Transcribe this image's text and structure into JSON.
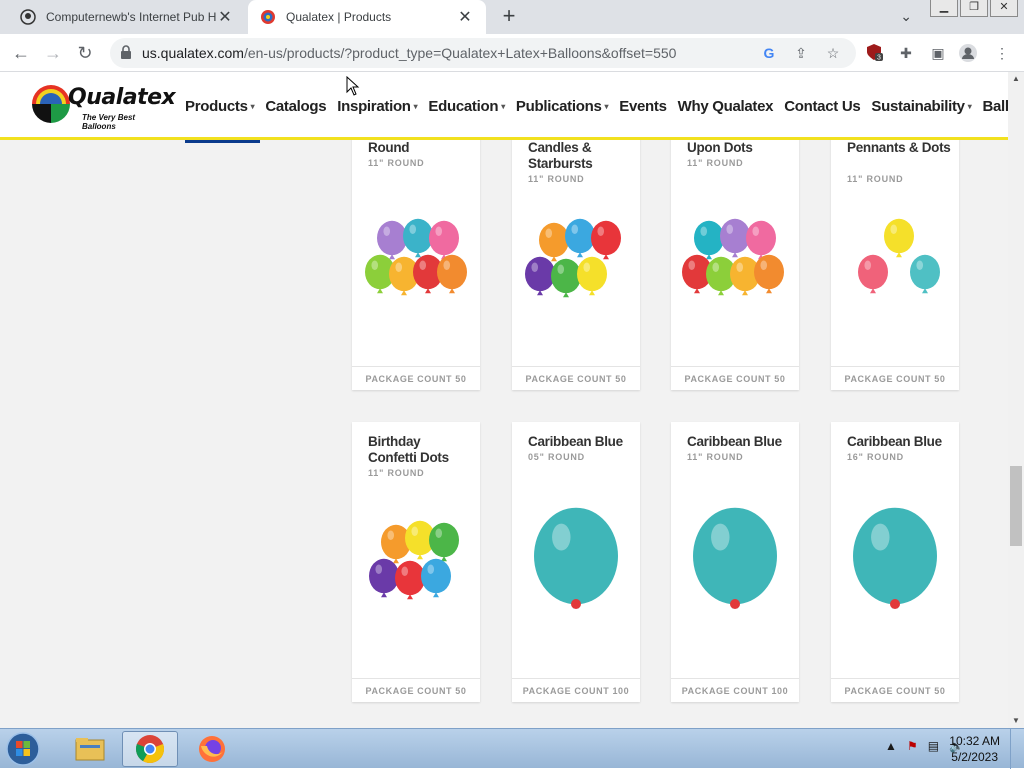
{
  "browser": {
    "tabs": [
      {
        "title": "Computernewb's Internet Pub H",
        "active": false
      },
      {
        "title": "Qualatex | Products",
        "active": true
      }
    ],
    "new_tab_label": "+",
    "url_host": "us.qualatex.com",
    "url_path": "/en-us/products/?product_type=Qualatex+Latex+Balloons&offset=550",
    "extension_badge": "3"
  },
  "site": {
    "logo_text": "Qualatex",
    "logo_tagline": "The Very Best Balloons",
    "nav": [
      {
        "label": "Products",
        "dropdown": true,
        "active": true
      },
      {
        "label": "Catalogs",
        "dropdown": false
      },
      {
        "label": "Inspiration",
        "dropdown": true
      },
      {
        "label": "Education",
        "dropdown": true
      },
      {
        "label": "Publications",
        "dropdown": true
      },
      {
        "label": "Events",
        "dropdown": false
      },
      {
        "label": "Why Qualatex",
        "dropdown": false
      },
      {
        "label": "Contact Us",
        "dropdown": false
      },
      {
        "label": "Sustainability",
        "dropdown": true
      },
      {
        "label": "Balloon Pro Fin",
        "dropdown": false
      }
    ],
    "dropdown_caret": "▾"
  },
  "products": [
    {
      "name": "Round",
      "size": "11\" ROUND",
      "package": "PACKAGE COUNT 50",
      "image": "assorted-birthday-balloons"
    },
    {
      "name": "Candles & Starbursts",
      "size": "11\" ROUND",
      "package": "PACKAGE COUNT 50",
      "image": "candles-starbursts-balloons"
    },
    {
      "name": "Upon Dots",
      "size": "11\" ROUND",
      "package": "PACKAGE COUNT 50",
      "image": "thank-you-dots-balloons"
    },
    {
      "name": "Pennants & Dots",
      "size": "11\" ROUND",
      "package": "PACKAGE COUNT 50",
      "image": "pennants-dots-balloons"
    },
    {
      "name": "Birthday Confetti Dots",
      "size": "11\" ROUND",
      "package": "PACKAGE COUNT 50",
      "image": "birthday-confetti-dots-balloons"
    },
    {
      "name": "Caribbean Blue",
      "size": "05\" ROUND",
      "package": "PACKAGE COUNT 100",
      "image": "caribbean-blue-balloon"
    },
    {
      "name": "Caribbean Blue",
      "size": "11\" ROUND",
      "package": "PACKAGE COUNT 100",
      "image": "caribbean-blue-balloon"
    },
    {
      "name": "Caribbean Blue",
      "size": "16\" ROUND",
      "package": "PACKAGE COUNT 50",
      "image": "caribbean-blue-balloon"
    }
  ],
  "colors": {
    "caribbean_blue": "#3fb6b8",
    "nav_underline": "#0b3b8c",
    "header_border": "#f2e11f"
  },
  "taskbar": {
    "time": "10:32 AM",
    "date": "5/2/2023"
  }
}
